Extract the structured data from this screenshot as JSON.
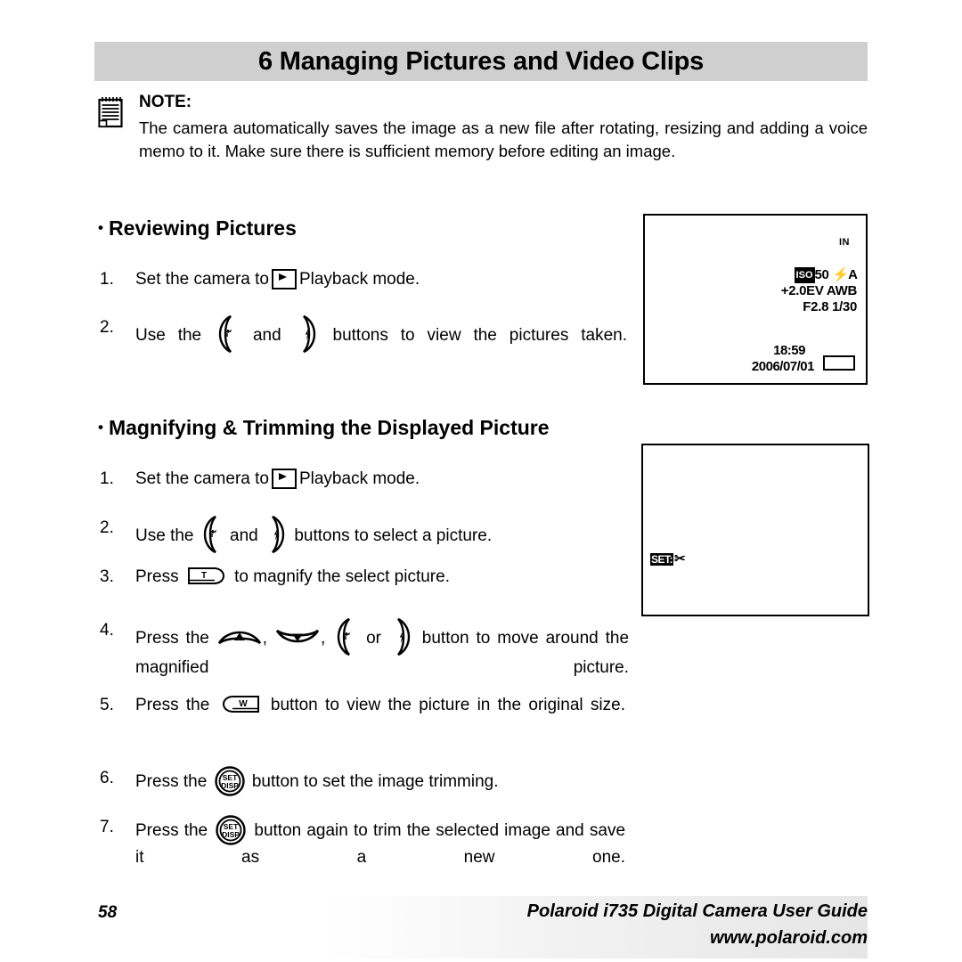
{
  "header": {
    "title": "6 Managing Pictures and Video Clips"
  },
  "note": {
    "icon": "notepad-icon",
    "label": "NOTE:",
    "text": "The camera automatically saves the image as a new file after rotating, resizing and adding a voice memo to it. Make sure there is sufficient memory before editing an image."
  },
  "sections": [
    {
      "bullet": "•",
      "heading": "Reviewing Pictures",
      "steps": [
        {
          "num": "1.",
          "part1": "Set the camera to",
          "part2": "Playback mode."
        },
        {
          "num": "2.",
          "part1": "Use the",
          "part2": "and",
          "part3": "buttons to view the pictures taken."
        }
      ]
    },
    {
      "bullet": "•",
      "heading": "Magnifying & Trimming the Displayed Picture",
      "steps": [
        {
          "num": "1.",
          "part1": "Set the camera to",
          "part2": "Playback mode."
        },
        {
          "num": "2.",
          "part1": "Use the",
          "part2": "and",
          "part3": "buttons to select a picture."
        },
        {
          "num": "3.",
          "part1": "Press",
          "part2": "to magnify the select picture."
        },
        {
          "num": "4.",
          "part1": "Press the",
          "part2": ",",
          "part3": ",",
          "part4": "or",
          "part5": "button to move around the magnified picture."
        },
        {
          "num": "5.",
          "part1": "Press the",
          "part2": "button to view the picture in the original size."
        },
        {
          "num": "6.",
          "part1": "Press the",
          "part2": "button to set the image trimming."
        },
        {
          "num": "7.",
          "part1": "Press the",
          "part2": "button again to trim the selected image and save it as a new one."
        }
      ]
    }
  ],
  "lcd_playback": {
    "memory_indicator": "IN",
    "iso_tag": "ISO",
    "iso_value": "50",
    "flash_mode": "A",
    "exposure_compensation": "+2.0EV",
    "white_balance": "AWB",
    "aperture": "F2.8",
    "shutter_speed": "1/30",
    "time": "18:59",
    "date": "2006/07/01",
    "battery": "battery-icon"
  },
  "lcd_trim": {
    "set_label": "SET:",
    "scissors": "✂"
  },
  "footer": {
    "page_number": "58",
    "guide_title": "Polaroid i735 Digital Camera User Guide",
    "url": "www.polaroid.com"
  },
  "colors": {
    "header_band": "#cfcfcf",
    "text": "#000000",
    "page_background": "#ffffff"
  }
}
